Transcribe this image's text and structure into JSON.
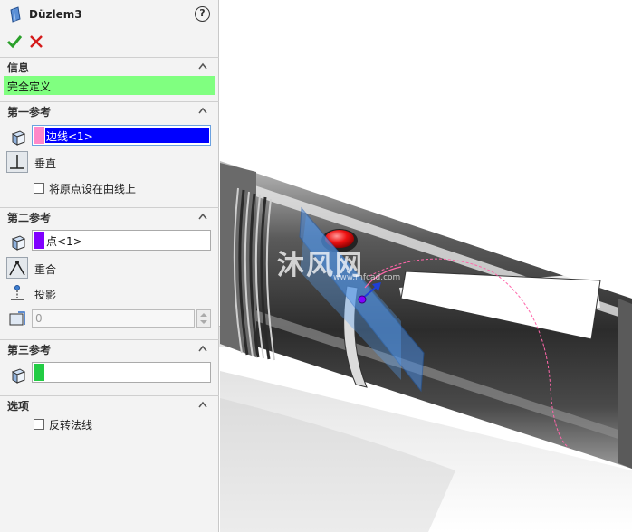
{
  "feature": {
    "title": "Düzlem3",
    "help": "?"
  },
  "sections": {
    "info": {
      "label": "信息",
      "status": "完全定义"
    },
    "first": {
      "label": "第一参考",
      "selection": "边线<1>",
      "swatch": "#ff88c8",
      "option": "垂直",
      "checkbox": "将原点设在曲线上"
    },
    "second": {
      "label": "第二参考",
      "selection": "点<1>",
      "swatch": "#8000ff",
      "option_coincident": "重合",
      "option_project": "投影",
      "value": "0"
    },
    "third": {
      "label": "第三参考",
      "selection": "",
      "swatch": "#22cc44"
    },
    "options": {
      "label": "选项",
      "checkbox": "反转法线"
    }
  },
  "colors": {
    "status_ok": "#80ff80",
    "selection_highlight": "#0000ff",
    "accent": "#3f7fd1"
  },
  "watermark": {
    "main": "沐风网",
    "sub": "www.mfcad.com"
  }
}
